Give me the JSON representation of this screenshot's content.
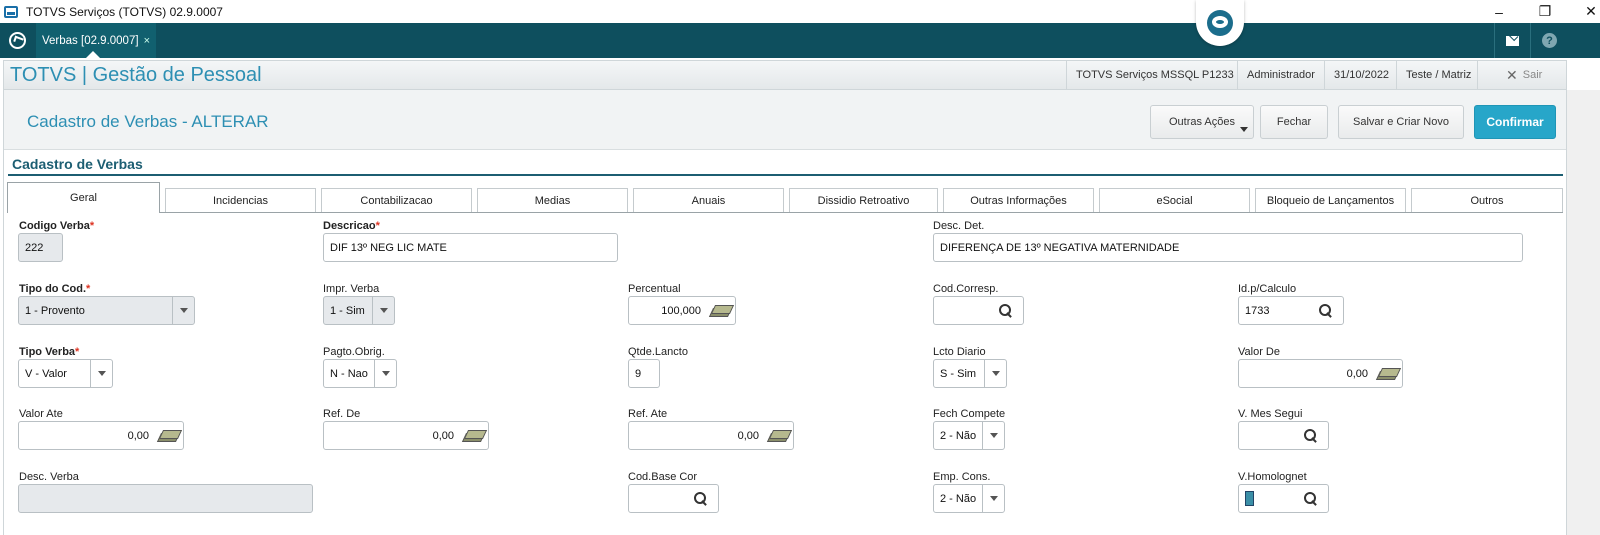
{
  "window": {
    "title": "TOTVS Serviços (TOTVS) 02.9.0007",
    "minimize": "–",
    "restore": "❐",
    "close": "✕"
  },
  "tabbar": {
    "tab_label": "Verbas [02.9.0007]",
    "tab_close": "×",
    "help_label": "?"
  },
  "header": {
    "app_title": "TOTVS | Gestão de Pessoal",
    "server": "TOTVS Serviços MSSQL P1233",
    "user": "Administrador",
    "date": "31/10/2022",
    "branch": "Teste / Matriz",
    "sair_icon": "✕",
    "sair_label": "Sair"
  },
  "page": {
    "title": "Cadastro de Verbas - ALTERAR",
    "section_title": "Cadastro de Verbas",
    "buttons": {
      "outras_acoes": "Outras Ações",
      "fechar": "Fechar",
      "salvar_criar": "Salvar e Criar Novo",
      "confirmar": "Confirmar"
    }
  },
  "tabs": [
    "Geral",
    "Incidencias",
    "Contabilizacao",
    "Medias",
    "Anuais",
    "Dissidio Retroativo",
    "Outras Informações",
    "eSocial",
    "Bloqueio de Lançamentos",
    "Outros"
  ],
  "form": {
    "codigo_verba": {
      "label": "Codigo Verba",
      "required": "*",
      "value": "222"
    },
    "descricao": {
      "label": "Descricao",
      "required": "*",
      "value": "DIF 13º NEG LIC MATE"
    },
    "desc_det": {
      "label": "Desc. Det.",
      "value": "DIFERENÇA DE 13º NEGATIVA MATERNIDADE"
    },
    "tipo_cod": {
      "label": "Tipo do Cod.",
      "required": "*",
      "value": "1 - Provento"
    },
    "impr_verba": {
      "label": "Impr. Verba",
      "value": "1 - Sim"
    },
    "percentual": {
      "label": "Percentual",
      "value": "100,000"
    },
    "cod_corresp": {
      "label": "Cod.Corresp.",
      "value": ""
    },
    "id_calculo": {
      "label": "Id.p/Calculo",
      "value": "1733"
    },
    "tipo_verba": {
      "label": "Tipo Verba",
      "required": "*",
      "value": "V - Valor"
    },
    "pagto_obrig": {
      "label": "Pagto.Obrig.",
      "value": "N - Nao"
    },
    "qtde_lancto": {
      "label": "Qtde.Lancto",
      "value": "9"
    },
    "lcto_diario": {
      "label": "Lcto Diario",
      "value": "S - Sim"
    },
    "valor_de": {
      "label": "Valor De",
      "value": "0,00"
    },
    "valor_ate": {
      "label": "Valor Ate",
      "value": "0,00"
    },
    "ref_de": {
      "label": "Ref. De",
      "value": "0,00"
    },
    "ref_ate": {
      "label": "Ref. Ate",
      "value": "0,00"
    },
    "fech_compete": {
      "label": "Fech Compete",
      "value": "2 - Não"
    },
    "v_mes_segui": {
      "label": "V. Mes Segui",
      "value": ""
    },
    "desc_verba": {
      "label": "Desc. Verba",
      "value": ""
    },
    "cod_base_cor": {
      "label": "Cod.Base Cor",
      "value": ""
    },
    "emp_cons": {
      "label": "Emp. Cons.",
      "value": "2 - Não"
    },
    "v_homolognet": {
      "label": "V.Homolognet",
      "value": ""
    }
  }
}
